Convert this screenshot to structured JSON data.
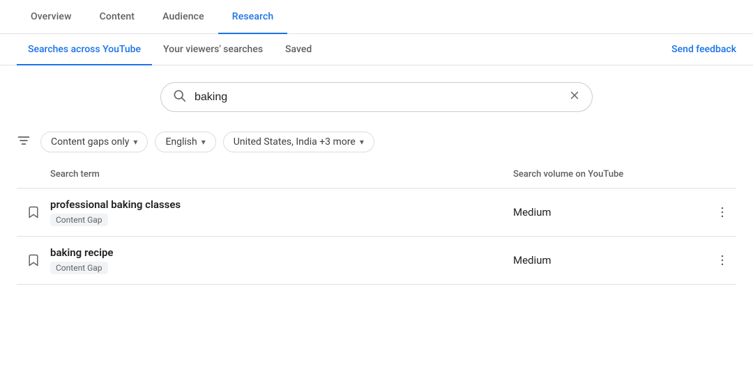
{
  "top_nav": {
    "items": [
      {
        "label": "Overview",
        "id": "overview",
        "active": false
      },
      {
        "label": "Content",
        "id": "content",
        "active": false
      },
      {
        "label": "Audience",
        "id": "audience",
        "active": false
      },
      {
        "label": "Research",
        "id": "research",
        "active": true
      }
    ]
  },
  "sub_nav": {
    "items": [
      {
        "label": "Searches across YouTube",
        "id": "searches-youtube",
        "active": true
      },
      {
        "label": "Your viewers' searches",
        "id": "viewers-searches",
        "active": false
      },
      {
        "label": "Saved",
        "id": "saved",
        "active": false
      }
    ],
    "feedback_label": "Send feedback"
  },
  "search": {
    "value": "baking",
    "placeholder": "Search"
  },
  "filters": {
    "filter_icon_label": "filter-icon",
    "chips": [
      {
        "label": "Content gaps only",
        "id": "content-gaps"
      },
      {
        "label": "English",
        "id": "language"
      },
      {
        "label": "United States, India +3 more",
        "id": "location"
      }
    ]
  },
  "table": {
    "headers": {
      "term": "Search term",
      "volume": "Search volume on YouTube"
    },
    "rows": [
      {
        "term": "professional baking classes",
        "badge": "Content Gap",
        "volume": "Medium"
      },
      {
        "term": "baking recipe",
        "badge": "Content Gap",
        "volume": "Medium"
      }
    ]
  }
}
